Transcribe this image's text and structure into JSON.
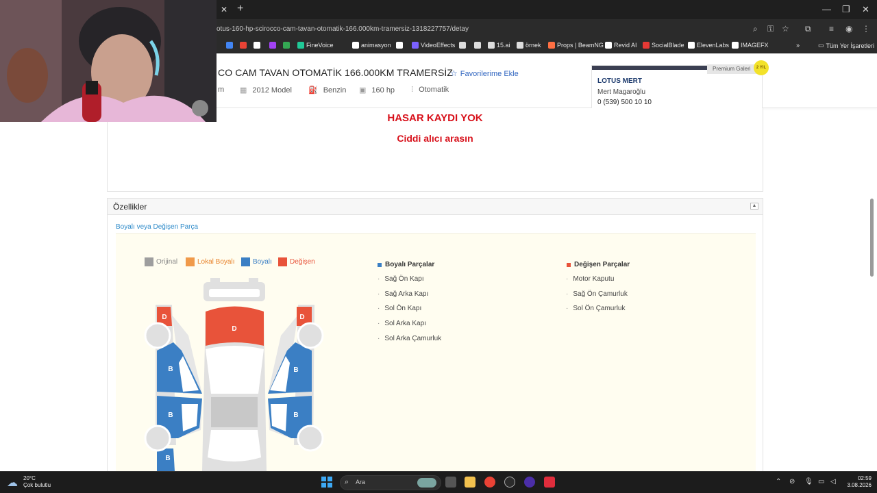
{
  "browser": {
    "url": "otus-160-hp-scirocco-cam-tavan-otomatik-166.000km-tramersiz-1318227757/detay",
    "bookmarks": [
      {
        "label": "",
        "color": "#4285f4"
      },
      {
        "label": "",
        "color": "#ea4335"
      },
      {
        "label": "",
        "color": "#ffffff"
      },
      {
        "label": "",
        "color": "#a142f4"
      },
      {
        "label": "",
        "color": "#34a853"
      },
      {
        "label": "FineVoice",
        "color": "#20c997"
      },
      {
        "label": "animasyon",
        "color": "#ffffff"
      },
      {
        "label": "",
        "color": "#ffffff"
      },
      {
        "label": "VideoEffects",
        "color": "#7b61ff"
      },
      {
        "label": "",
        "color": "#dddddd"
      },
      {
        "label": "",
        "color": "#dddddd"
      },
      {
        "label": "15.ai",
        "color": "#dddddd"
      },
      {
        "label": "örnek",
        "color": "#dddddd"
      },
      {
        "label": "Props | BeamNG",
        "color": "#ff7043"
      },
      {
        "label": "Revid AI",
        "color": "#ffffff"
      },
      {
        "label": "SocialBlade",
        "color": "#e53935"
      },
      {
        "label": "ElevenLabs",
        "color": "#ffffff"
      },
      {
        "label": "IMAGEFX",
        "color": "#ffffff"
      }
    ],
    "all_bookmarks": "Tüm Yer İşaretleri"
  },
  "listing": {
    "title": "CO CAM TAVAN OTOMATİK 166.000KM TRAMERSİZ",
    "favorite": "Favorilerime Ekle",
    "specs": {
      "km": "m",
      "model": "2012 Model",
      "fuel": "Benzin",
      "power": "160 hp",
      "gear": "Otomatik"
    }
  },
  "seller": {
    "badge": "Premium Galeri",
    "seal": "2 YIL",
    "name": "LOTUS MERT",
    "person": "Mert Magaroğlu",
    "phone": "0 (539) 500 10 10"
  },
  "description": {
    "line1": "HASAR KAYDI YOK",
    "line2": "Ciddi alıcı arasın"
  },
  "features": {
    "title": "Özellikler",
    "subtitle": "Boyalı veya Değişen Parça",
    "legend": [
      {
        "label": "Orijinal",
        "color": "#9e9e9e"
      },
      {
        "label": "Lokal Boyalı",
        "color": "#f09a4a"
      },
      {
        "label": "Boyalı",
        "color": "#3b7fc4"
      },
      {
        "label": "Değişen",
        "color": "#e8533a"
      }
    ],
    "part_letters": {
      "painted": "B",
      "changed": "D"
    },
    "painted": {
      "title": "Boyalı Parçalar",
      "items": [
        "Sağ Ön Kapı",
        "Sağ Arka Kapı",
        "Sol Ön Kapı",
        "Sol Arka Kapı",
        "Sol Arka Çamurluk"
      ]
    },
    "changed": {
      "title": "Değişen Parçalar",
      "items": [
        "Motor Kaputu",
        "Sağ Ön Çamurluk",
        "Sol Ön Çamurluk"
      ]
    }
  },
  "taskbar": {
    "temperature": "20°C",
    "weather": "Çok bulutlu",
    "search": "Ara",
    "time": "02:59",
    "date": "3.08.2026"
  },
  "colors": {
    "accent_blue": "#2d8ac9",
    "alert_red": "#d8111b",
    "painted_blue": "#3b7fc4",
    "changed_red": "#e8533a"
  }
}
